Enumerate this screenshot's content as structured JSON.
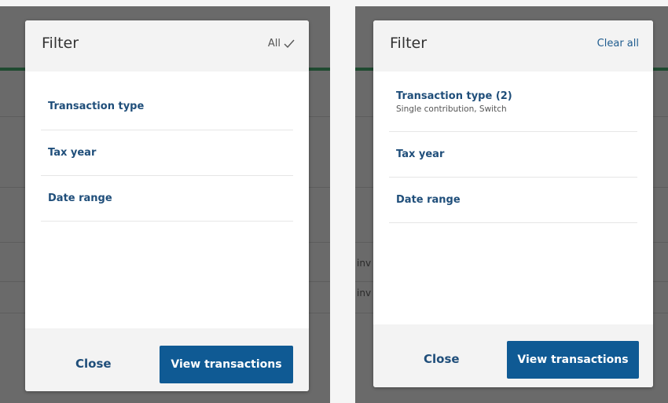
{
  "left_panel": {
    "title": "Filter",
    "header_action": "All",
    "header_action_icon": "check-icon",
    "items": [
      {
        "label": "Transaction type"
      },
      {
        "label": "Tax year"
      },
      {
        "label": "Date range"
      }
    ],
    "close_label": "Close",
    "primary_label": "View transactions"
  },
  "right_panel": {
    "title": "Filter",
    "header_action": "Clear all",
    "items": [
      {
        "label": "Transaction type (2)",
        "sublabel": "Single contribution, Switch"
      },
      {
        "label": "Tax year"
      },
      {
        "label": "Date range"
      }
    ],
    "close_label": "Close",
    "primary_label": "View transactions"
  },
  "background": {
    "peek_text": [
      "inv",
      "inv"
    ]
  },
  "colors": {
    "primary": "#0f5a94",
    "link": "#1f4e7a",
    "overlay": "#6a6a6a"
  }
}
